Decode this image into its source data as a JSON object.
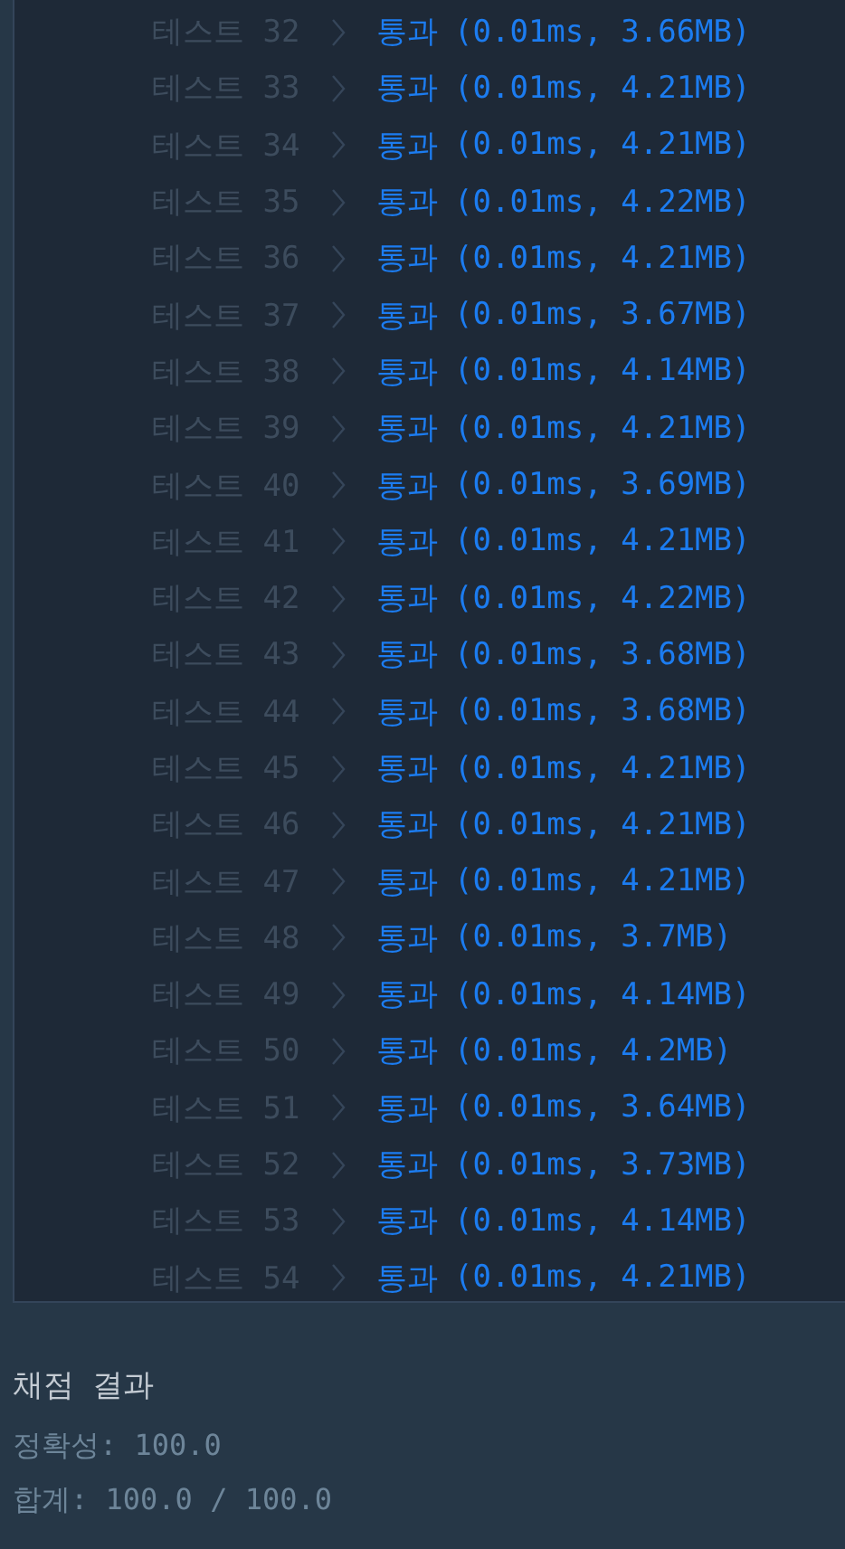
{
  "tests": [
    {
      "label": "테스트 32",
      "status": "통과",
      "detail": "(0.01ms, 3.66MB)"
    },
    {
      "label": "테스트 33",
      "status": "통과",
      "detail": "(0.01ms, 4.21MB)"
    },
    {
      "label": "테스트 34",
      "status": "통과",
      "detail": "(0.01ms, 4.21MB)"
    },
    {
      "label": "테스트 35",
      "status": "통과",
      "detail": "(0.01ms, 4.22MB)"
    },
    {
      "label": "테스트 36",
      "status": "통과",
      "detail": "(0.01ms, 4.21MB)"
    },
    {
      "label": "테스트 37",
      "status": "통과",
      "detail": "(0.01ms, 3.67MB)"
    },
    {
      "label": "테스트 38",
      "status": "통과",
      "detail": "(0.01ms, 4.14MB)"
    },
    {
      "label": "테스트 39",
      "status": "통과",
      "detail": "(0.01ms, 4.21MB)"
    },
    {
      "label": "테스트 40",
      "status": "통과",
      "detail": "(0.01ms, 3.69MB)"
    },
    {
      "label": "테스트 41",
      "status": "통과",
      "detail": "(0.01ms, 4.21MB)"
    },
    {
      "label": "테스트 42",
      "status": "통과",
      "detail": "(0.01ms, 4.22MB)"
    },
    {
      "label": "테스트 43",
      "status": "통과",
      "detail": "(0.01ms, 3.68MB)"
    },
    {
      "label": "테스트 44",
      "status": "통과",
      "detail": "(0.01ms, 3.68MB)"
    },
    {
      "label": "테스트 45",
      "status": "통과",
      "detail": "(0.01ms, 4.21MB)"
    },
    {
      "label": "테스트 46",
      "status": "통과",
      "detail": "(0.01ms, 4.21MB)"
    },
    {
      "label": "테스트 47",
      "status": "통과",
      "detail": "(0.01ms, 4.21MB)"
    },
    {
      "label": "테스트 48",
      "status": "통과",
      "detail": "(0.01ms, 3.7MB)"
    },
    {
      "label": "테스트 49",
      "status": "통과",
      "detail": "(0.01ms, 4.14MB)"
    },
    {
      "label": "테스트 50",
      "status": "통과",
      "detail": "(0.01ms, 4.2MB)"
    },
    {
      "label": "테스트 51",
      "status": "통과",
      "detail": "(0.01ms, 3.64MB)"
    },
    {
      "label": "테스트 52",
      "status": "통과",
      "detail": "(0.01ms, 3.73MB)"
    },
    {
      "label": "테스트 53",
      "status": "통과",
      "detail": "(0.01ms, 4.14MB)"
    },
    {
      "label": "테스트 54",
      "status": "통과",
      "detail": "(0.01ms, 4.21MB)"
    }
  ],
  "result": {
    "title": "채점 결과",
    "accuracy": "정확성: 100.0",
    "total": "합계: 100.0 / 100.0"
  }
}
